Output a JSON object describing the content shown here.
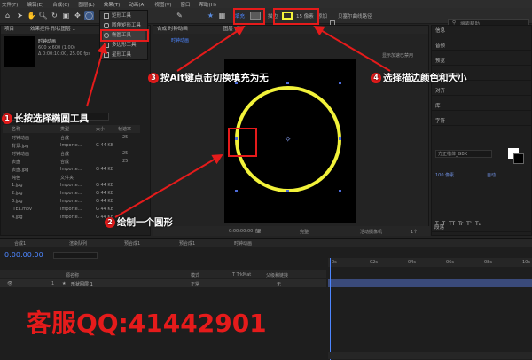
{
  "menu": [
    "文件(F)",
    "编辑(E)",
    "合成(C)",
    "图层(L)",
    "效果(T)",
    "动画(A)",
    "视图(V)",
    "窗口",
    "帮助(H)"
  ],
  "toolbar": {
    "fill_label": "填充",
    "stroke_label": "描边",
    "stroke_size": "15 像素",
    "add_label": "添加",
    "snap_label": "贝塞尔曲线路径",
    "help_search": "搜索帮助",
    "fill_color": "#5a5a5a",
    "stroke_color": "#f2f23a"
  },
  "shape_menu": {
    "items": [
      "矩形工具",
      "圆角矩形工具",
      "椭圆工具",
      "多边形工具",
      "星形工具"
    ],
    "selected_index": 2
  },
  "project": {
    "tab": "项目",
    "effects_tab": "效果控件 形状图层 1",
    "comp_name": "时钟动画",
    "comp_info1": "600 x 600 (1.00)",
    "comp_info2": "Δ 0:00:10:00, 25.00 fps",
    "columns": [
      "名称",
      "类型",
      "大小",
      "帧速率"
    ],
    "items": [
      {
        "name": "时钟动画",
        "type": "合成",
        "size": "",
        "fps": "25"
      },
      {
        "name": "背景.jpg",
        "type": "Importe...",
        "size": "G 44 KB",
        "fps": ""
      },
      {
        "name": "时钟动画",
        "type": "合成",
        "size": "",
        "fps": "25"
      },
      {
        "name": "表盘",
        "type": "合成",
        "size": "",
        "fps": "25"
      },
      {
        "name": "表盘.jpg",
        "type": "Importe...",
        "size": "G 44 KB",
        "fps": ""
      },
      {
        "name": "纯色",
        "type": "文件夹",
        "size": "",
        "fps": ""
      },
      {
        "name": "1.jpg",
        "type": "Importe...",
        "size": "G 44 KB",
        "fps": ""
      },
      {
        "name": "2.jpg",
        "type": "Importe...",
        "size": "G 44 KB",
        "fps": ""
      },
      {
        "name": "3.jpg",
        "type": "Importe...",
        "size": "G 44 KB",
        "fps": ""
      },
      {
        "name": "ITEL.mov",
        "type": "Importe...",
        "size": "G 44 KB",
        "fps": ""
      },
      {
        "name": "4.jpg",
        "type": "Importe...",
        "size": "G 44 KB",
        "fps": ""
      }
    ]
  },
  "viewer": {
    "tab": "合成 时钟动画",
    "breadcrumb": "时钟动画",
    "layer_tab": "图层 (无)",
    "accel_note": "显示加速已禁用",
    "timecode": "0:00:00:00",
    "quality": "完整",
    "camera": "活动摄像机",
    "views": "1个",
    "zoom": "(50%)"
  },
  "right_panel": {
    "sections": [
      "信息",
      "音频",
      "预览",
      "效果和预设",
      "对齐",
      "库",
      "字符"
    ],
    "char_font": "方正楷体_GBK",
    "font_size": "100 像素",
    "tracking": "自动",
    "paragraph_title": "段落"
  },
  "timeline": {
    "tabs": [
      "合成1",
      "渲染队列",
      "预合成1",
      "预合成1",
      "时钟动画"
    ],
    "timecode": "0:00:00:00",
    "columns": [
      "源名称",
      "模式",
      "T TrkMat",
      "父级和链接"
    ],
    "layer_num": "1",
    "layer_name": "形状图层 1",
    "layer_mode": "正常",
    "layer_parent": "无",
    "ruler": [
      "0s",
      "02s",
      "04s",
      "06s",
      "08s",
      "10s"
    ]
  },
  "annotations": [
    {
      "num": "1",
      "text": "长按选择椭圆工具"
    },
    {
      "num": "2",
      "text": "绘制一个圆形"
    },
    {
      "num": "3",
      "text": "按Alt键点击切换填充为无"
    },
    {
      "num": "4",
      "text": "选择描边颜色和大小"
    }
  ],
  "watermark": "客服QQ:41442901"
}
